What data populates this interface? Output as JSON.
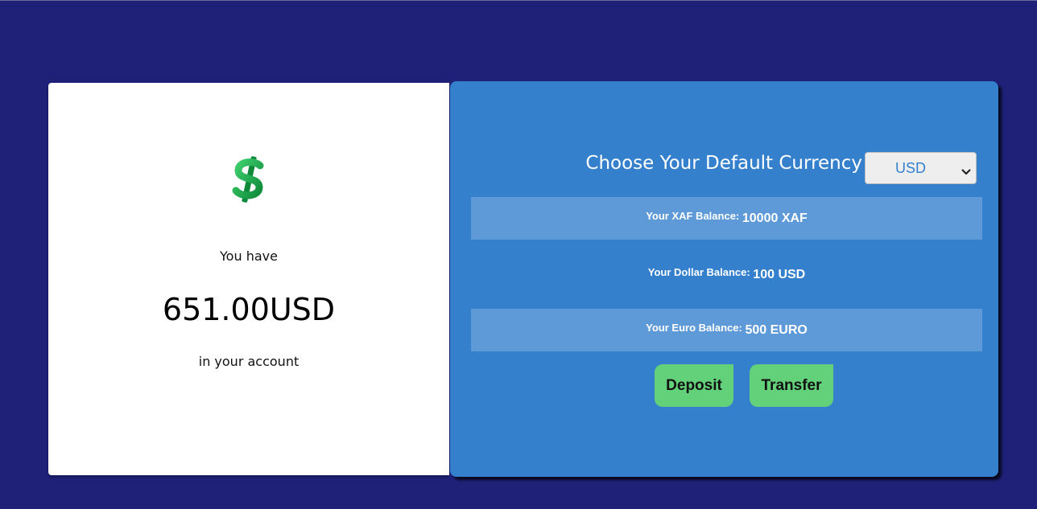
{
  "summary": {
    "icon": "heavy-dollar-sign-icon",
    "intro": "You have",
    "amount": "651.00USD",
    "outro": "in your account"
  },
  "settings": {
    "heading": "Choose Your Default Currency",
    "selected_currency": "USD"
  },
  "balances": [
    {
      "label": "Your XAF Balance:",
      "value": "10000 XAF"
    },
    {
      "label": "Your Dollar Balance:",
      "value": "100 USD"
    },
    {
      "label": "Your Euro Balance:",
      "value": "500 EURO"
    }
  ],
  "actions": {
    "deposit_label": "Deposit",
    "transfer_label": "Transfer"
  },
  "colors": {
    "page_background": "#1f2179",
    "panel_blue": "#3580cd",
    "row_shade": "#5f9ad8",
    "button_green": "#63d17a",
    "dollar_green": "#1aa34a"
  }
}
